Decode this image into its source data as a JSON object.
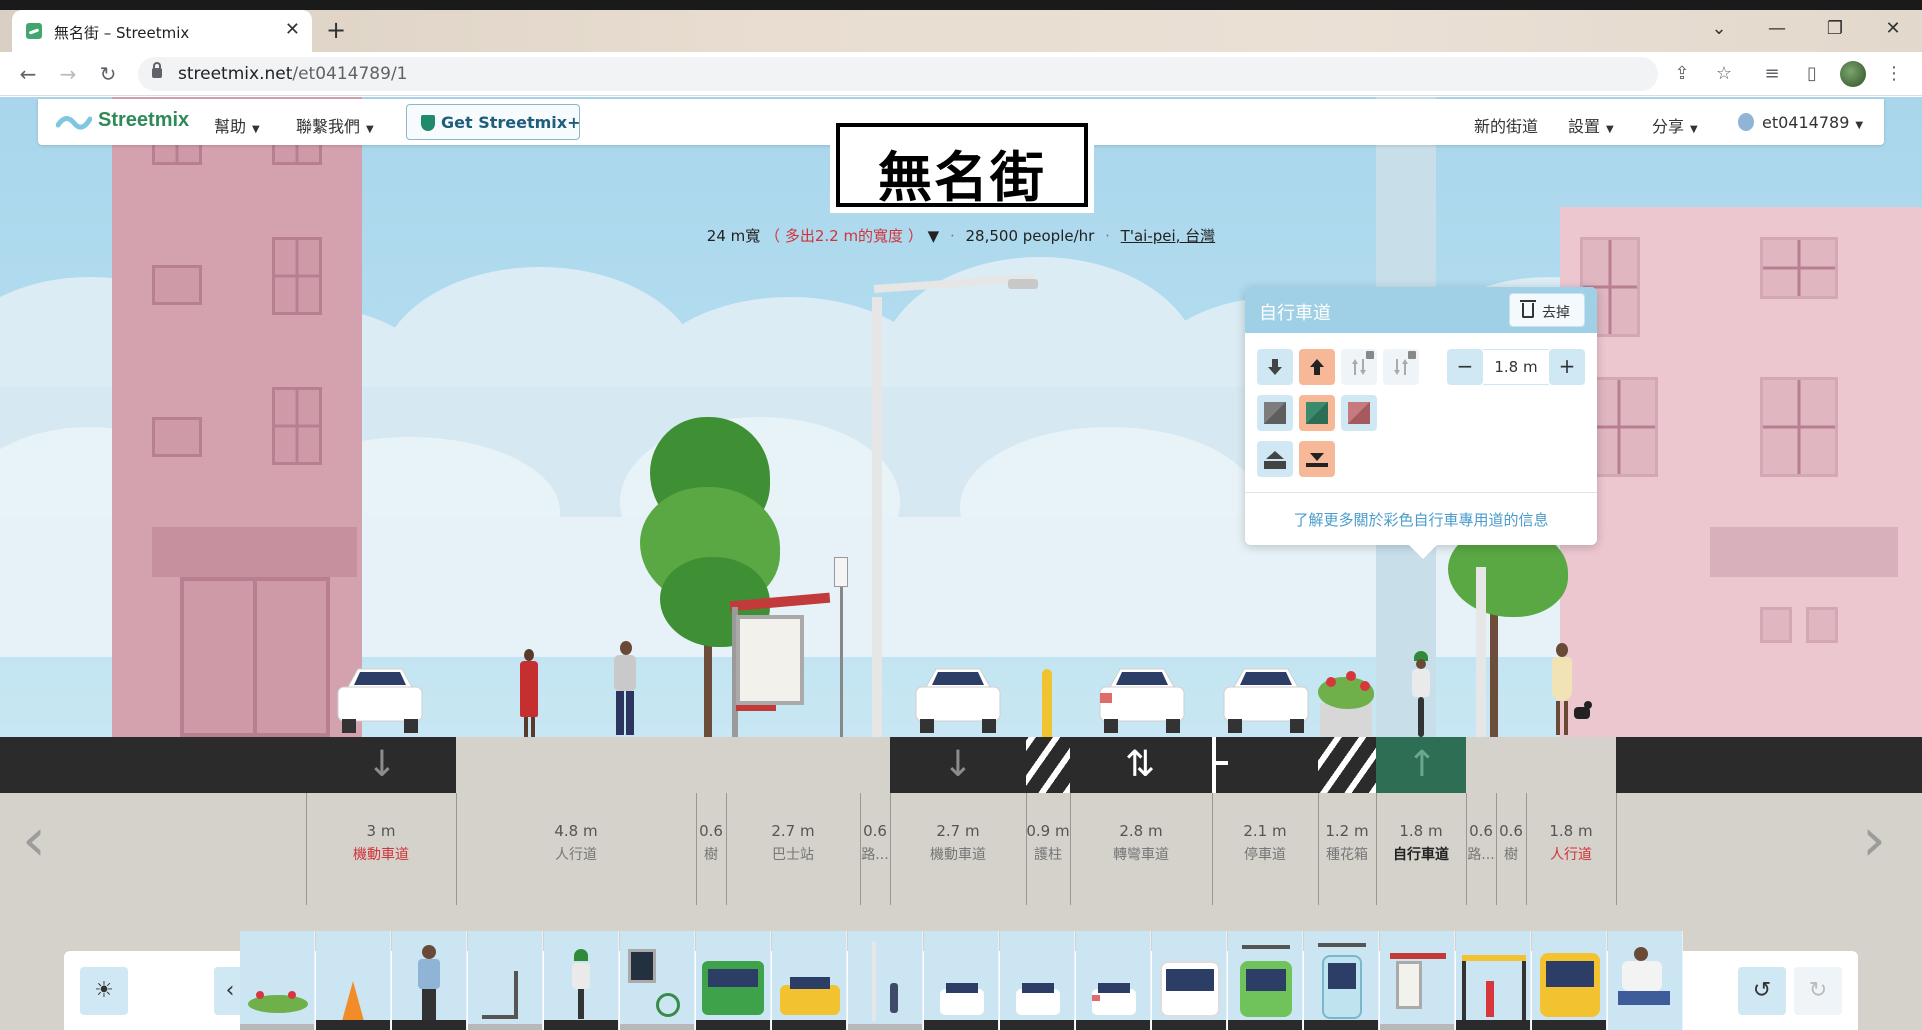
{
  "browser": {
    "tab_title": "無名街 – Streetmix",
    "url_host": "streetmix.net",
    "url_path": "/et0414789/1"
  },
  "nav": {
    "brand": "Streetmix",
    "help": "幫助",
    "contact": "聯繫我們",
    "get_plus": "Get Streetmix+",
    "new_street": "新的街道",
    "settings": "設置",
    "share": "分享",
    "user": "et0414789"
  },
  "street": {
    "name": "無名街",
    "width": "24 m寬",
    "over_width": "（ 多出2.2 m的寬度 ）",
    "capacity": "28,500 people/hr",
    "location": "T'ai-pei, 台灣"
  },
  "popup": {
    "title": "自行車道",
    "remove": "去掉",
    "width_value": "1.8 m",
    "minus": "−",
    "plus": "+",
    "learn_more": "了解更多關於彩色自行車專用道的信息"
  },
  "segments": [
    {
      "width": "3 m",
      "name": "機動車道",
      "warn": true
    },
    {
      "width": "4.8 m",
      "name": "人行道"
    },
    {
      "width": "0.6",
      "name": "樹"
    },
    {
      "width": "2.7 m",
      "name": "巴士站"
    },
    {
      "width": "0.6",
      "name": "路..."
    },
    {
      "width": "2.7 m",
      "name": "機動車道"
    },
    {
      "width": "0.9 m",
      "name": "護柱"
    },
    {
      "width": "2.8 m",
      "name": "轉彎車道"
    },
    {
      "width": "2.1 m",
      "name": "停車道"
    },
    {
      "width": "1.2 m",
      "name": "種花箱"
    },
    {
      "width": "1.8 m",
      "name": "自行車道",
      "selected": true
    },
    {
      "width": "0.6",
      "name": "路..."
    },
    {
      "width": "0.6",
      "name": "樹"
    },
    {
      "width": "1.8 m",
      "name": "人行道",
      "warn": true
    }
  ],
  "colors": {
    "brand_green": "#2f8a57",
    "warning_red": "#d0353b",
    "bike_lane_green": "#2d6e55",
    "popup_header": "#9fd0e6"
  }
}
